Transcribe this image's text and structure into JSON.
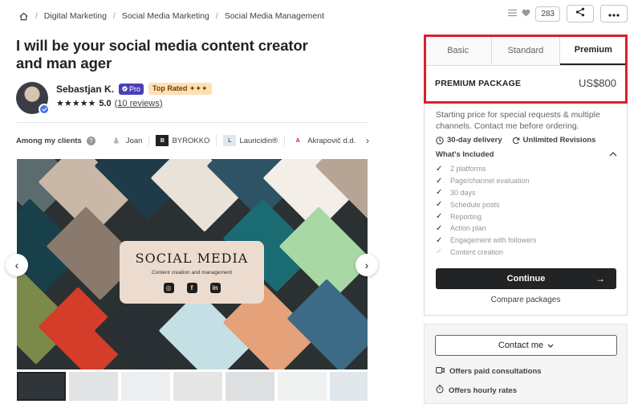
{
  "breadcrumb": {
    "items": [
      "Digital Marketing",
      "Social Media Marketing",
      "Social Media Management"
    ]
  },
  "top_actions": {
    "favorite_count": "283"
  },
  "gig": {
    "title": "I will be your social media content creator and man ager"
  },
  "seller": {
    "name": "Sebastjan K.",
    "pro_label": "Pro",
    "top_rated_label": "Top Rated ✦✦✦",
    "stars": "★★★★★",
    "rating": "5.0",
    "reviews": "(10 reviews)"
  },
  "clients": {
    "label": "Among my clients",
    "help": "?",
    "items": [
      {
        "name": "Joan",
        "logo_text": "⛪"
      },
      {
        "name": "BYROKKO",
        "logo_text": "B"
      },
      {
        "name": "Lauricidin®",
        "logo_text": "L"
      },
      {
        "name": "Akrapovič d.d.",
        "logo_text": "A"
      }
    ]
  },
  "hero": {
    "card_title": "SOCIAL MEDIA",
    "card_subtitle": "Content creation and management",
    "social_icons": [
      "instagram-icon",
      "facebook-icon",
      "linkedin-icon"
    ]
  },
  "packages": {
    "tabs": [
      "Basic",
      "Standard",
      "Premium"
    ],
    "active_tab": "Premium",
    "name": "PREMIUM PACKAGE",
    "price": "US$800",
    "description": "Starting price for special requests & multiple channels. Contact me before ordering.",
    "delivery": "30-day delivery",
    "revisions": "Unlimited Revisions",
    "included_label": "What's Included",
    "features": [
      {
        "label": "2 platforms",
        "included": true
      },
      {
        "label": "Page/channel evaluation",
        "included": true
      },
      {
        "label": "30 days",
        "included": true
      },
      {
        "label": "Schedule posts",
        "included": true
      },
      {
        "label": "Reporting",
        "included": true
      },
      {
        "label": "Action plan",
        "included": true
      },
      {
        "label": "Engagement with followers",
        "included": true
      },
      {
        "label": "Content creation",
        "included": false
      }
    ],
    "continue_label": "Continue",
    "compare_label": "Compare packages"
  },
  "contact": {
    "button_label": "Contact me",
    "offers": [
      "Offers paid consultations",
      "Offers hourly rates"
    ]
  },
  "colors": {
    "highlight": "#d9202f",
    "pro_badge": "#4a3fb8",
    "top_rated_bg": "#ffe0b3",
    "primary_button": "#222325"
  }
}
